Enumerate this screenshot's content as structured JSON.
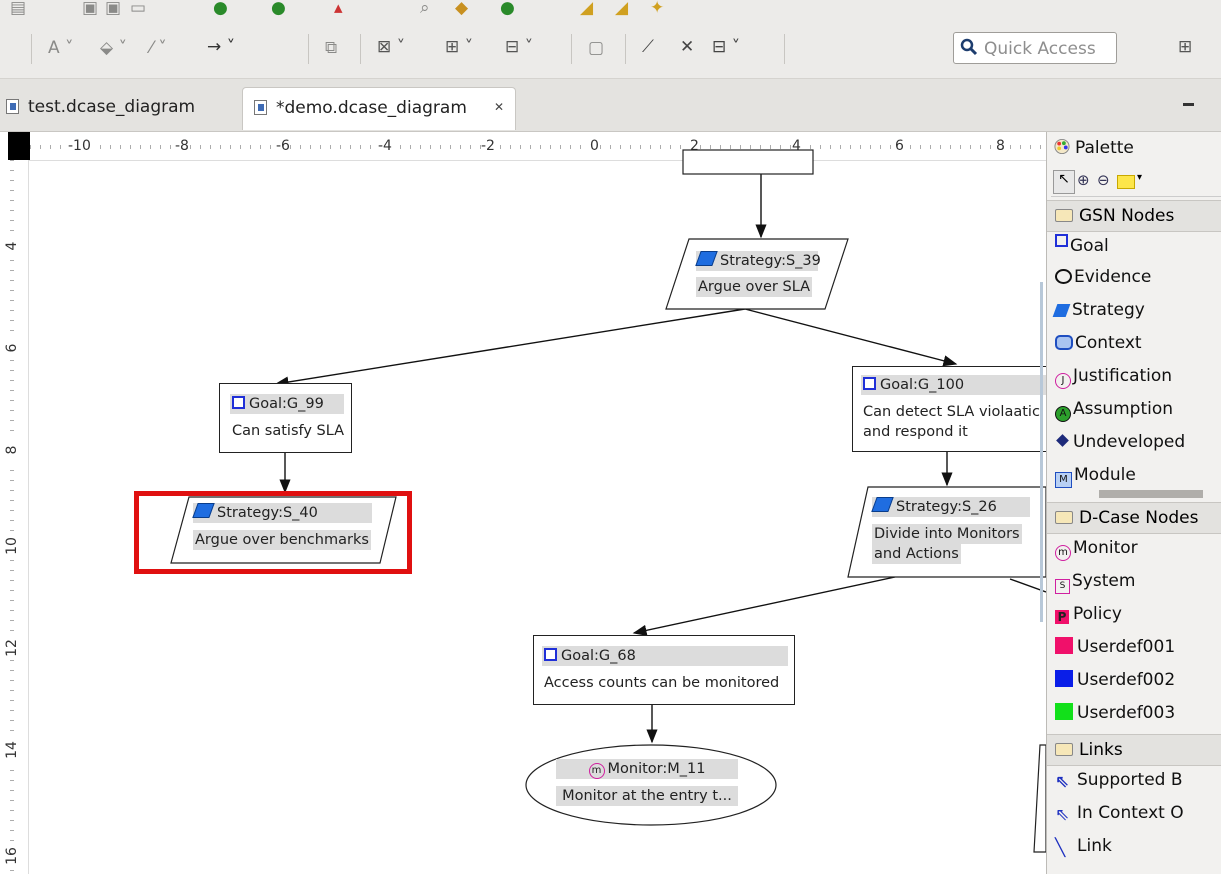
{
  "toolbar": {
    "quick_access_placeholder": "Quick Access"
  },
  "tabs": [
    {
      "label": "test.dcase_diagram"
    },
    {
      "label": "*demo.dcase_diagram",
      "close": "✕"
    }
  ],
  "ruler": {
    "top_labels": [
      "-10",
      "-8",
      "-6",
      "-4",
      "-2",
      "0",
      "2",
      "4",
      "6",
      "8"
    ],
    "left_labels": [
      "4",
      "6",
      "8",
      "10",
      "12",
      "14",
      "16"
    ]
  },
  "diagram": {
    "strategy_s39": {
      "title": "Strategy:S_39",
      "desc": "Argue over SLA"
    },
    "goal_g99": {
      "title": "Goal:G_99",
      "desc": "Can satisfy SLA"
    },
    "goal_g100": {
      "title": "Goal:G_100",
      "desc1": "Can detect SLA violaatic",
      "desc2": "and respond it"
    },
    "strategy_s40": {
      "title": "Strategy:S_40",
      "desc": "Argue over benchmarks"
    },
    "strategy_s26": {
      "title": "Strategy:S_26",
      "desc1": "Divide into Monitors",
      "desc2": "and Actions"
    },
    "goal_g68": {
      "title": "Goal:G_68",
      "desc": "Access counts can be monitored"
    },
    "monitor_m11": {
      "title": "Monitor:M_11",
      "desc": "Monitor at the entry t..."
    }
  },
  "palette": {
    "title": "Palette",
    "gsn_section": "GSN Nodes",
    "gsn_items": [
      "Goal",
      "Evidence",
      "Strategy",
      "Context",
      "Justification",
      "Assumption",
      "Undeveloped",
      "Module"
    ],
    "dcase_section": "D-Case Nodes",
    "dcase_items": [
      "Monitor",
      "System",
      "Policy",
      "Userdef001",
      "Userdef002",
      "Userdef003"
    ],
    "links_section": "Links",
    "link_items": [
      "Supported B",
      "In Context O",
      "Link"
    ]
  },
  "colors": {
    "highlight": "#e01010",
    "goal_blue": "#2030d8",
    "strategy_blue": "#1f6de0",
    "userdef001": "#f0106a",
    "userdef002": "#0a1ee8",
    "userdef003": "#12e01a"
  }
}
